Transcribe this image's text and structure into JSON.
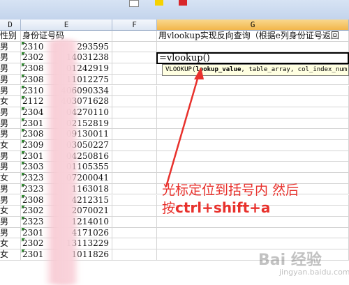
{
  "columns": {
    "D": "D",
    "E": "E",
    "F": "F",
    "G": "G"
  },
  "header_row": {
    "d": "性别",
    "e": "身份证号码",
    "g": "用vlookup实现反向查询（根据e列身份证号返回"
  },
  "active_cell": {
    "formula": "=vlookup()"
  },
  "tooltip": {
    "func": "VLOOKUP",
    "open": "(",
    "arg1": "lookup_value",
    "rest": ", table_array, col_index_num, ["
  },
  "rows": [
    {
      "gender": "男",
      "id_prefix": "2310",
      "id_suffix": "293595"
    },
    {
      "gender": "男",
      "id_prefix": "2302",
      "id_suffix": "14031238"
    },
    {
      "gender": "男",
      "id_prefix": "2308",
      "id_suffix": "01242919"
    },
    {
      "gender": "男",
      "id_prefix": "2308",
      "id_suffix": "11012275"
    },
    {
      "gender": "男",
      "id_prefix": "2310",
      "id_suffix": "406090334"
    },
    {
      "gender": "女",
      "id_prefix": "2112",
      "id_suffix": "403071628"
    },
    {
      "gender": "男",
      "id_prefix": "2304",
      "id_suffix": "04270110"
    },
    {
      "gender": "男",
      "id_prefix": "2301",
      "id_suffix": "02152819"
    },
    {
      "gender": "男",
      "id_prefix": "2308",
      "id_suffix": "09130011"
    },
    {
      "gender": "女",
      "id_prefix": "2309",
      "id_suffix": "03050227"
    },
    {
      "gender": "男",
      "id_prefix": "2301",
      "id_suffix": "04250816"
    },
    {
      "gender": "男",
      "id_prefix": "2303",
      "id_suffix": "01105355"
    },
    {
      "gender": "女",
      "id_prefix": "2323",
      "id_suffix": "07200041"
    },
    {
      "gender": "男",
      "id_prefix": "2323",
      "id_suffix": "1163018"
    },
    {
      "gender": "男",
      "id_prefix": "2308",
      "id_suffix": "4212315"
    },
    {
      "gender": "女",
      "id_prefix": "2302",
      "id_suffix": "2070021"
    },
    {
      "gender": "男",
      "id_prefix": "2323",
      "id_suffix": "1214010"
    },
    {
      "gender": "男",
      "id_prefix": "2301",
      "id_suffix": "4171026"
    },
    {
      "gender": "女",
      "id_prefix": "2302",
      "id_suffix": "13113229"
    },
    {
      "gender": "女",
      "id_prefix": "2301",
      "id_suffix": "1011826"
    }
  ],
  "annotation": {
    "line1": "光标定位到括号内 然后",
    "line2_prefix": "按",
    "line2_keys": "ctrl+shift+a"
  },
  "watermark": {
    "text": "Bai 经验",
    "sub": "jingyan.baidu.com"
  },
  "colors": {
    "annotation": "#e8312c",
    "arrow": "#e8312c",
    "selected_header": "#f2b64b"
  }
}
